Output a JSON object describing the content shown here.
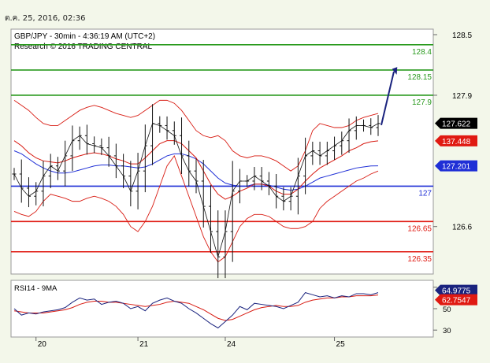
{
  "header": {
    "timestamp": "ต.ค. 25, 2016, 02:36"
  },
  "chart_data": [
    {
      "type": "line",
      "title": "GBP/JPY - 30min - 4:36:19 AM (UTC+2)",
      "subtitle": "Research © 2016 TRADING CENTRAL",
      "x_ticks": [
        "20",
        "21",
        "24",
        "25"
      ],
      "ylim": [
        126.2,
        128.5
      ],
      "y_ticks": [
        {
          "value": 128.5,
          "label": "128.5"
        },
        {
          "value": 127.9,
          "label": "127.9"
        },
        {
          "value": 126.6,
          "label": "126.6"
        }
      ],
      "levels": [
        {
          "value": 128.4,
          "label": "128.4",
          "color": "#2a9a1e",
          "role": "target"
        },
        {
          "value": 128.15,
          "label": "128.15",
          "color": "#2a9a1e",
          "role": "target"
        },
        {
          "value": 127.9,
          "label": "127.9",
          "color": "#2a9a1e",
          "role": "target"
        },
        {
          "value": 127.0,
          "label": "127",
          "color": "#1f2fd6",
          "role": "pivot"
        },
        {
          "value": 126.65,
          "label": "126.65",
          "color": "#e01a12",
          "role": "support"
        },
        {
          "value": 126.35,
          "label": "126.35",
          "color": "#e01a12",
          "role": "support"
        }
      ],
      "markers": [
        {
          "value": 127.622,
          "label": "127.622",
          "color": "#000000"
        },
        {
          "value": 127.448,
          "label": "137.448",
          "color": "#e01a12"
        },
        {
          "value": 127.201,
          "label": "127.201",
          "color": "#1f2fd6"
        }
      ],
      "series": [
        {
          "values": [
            127.12,
            126.98,
            126.9,
            126.95,
            127.1,
            127.2,
            127.15,
            127.3,
            127.45,
            127.5,
            127.42,
            127.4,
            127.38,
            127.3,
            127.2,
            127.1,
            126.95,
            127.15,
            127.4,
            127.62,
            127.6,
            127.55,
            127.5,
            127.3,
            127.15,
            127.05,
            126.8,
            126.55,
            126.3,
            126.55,
            126.95,
            127.05,
            127.05,
            127.1,
            127.05,
            127.0,
            126.9,
            126.85,
            126.9,
            127.1,
            127.3,
            127.35,
            127.3,
            127.35,
            127.4,
            127.45,
            127.55,
            127.6,
            127.6,
            127.58,
            127.62
          ]
        },
        {
          "values": [
            127.45,
            127.4,
            127.33,
            127.28,
            127.25,
            127.24,
            127.23,
            127.25,
            127.28,
            127.3,
            127.32,
            127.33,
            127.32,
            127.3,
            127.27,
            127.25,
            127.22,
            127.22,
            127.28,
            127.35,
            127.42,
            127.45,
            127.45,
            127.42,
            127.35,
            127.28,
            127.15,
            127.02,
            126.92,
            126.87,
            126.9,
            126.95,
            126.98,
            127.02,
            127.02,
            127.0,
            126.95,
            126.92,
            126.92,
            126.97,
            127.05,
            127.12,
            127.18,
            127.22,
            127.26,
            127.3,
            127.35,
            127.38,
            127.42,
            127.44,
            127.448
          ]
        },
        {
          "values": [
            127.35,
            127.32,
            127.27,
            127.22,
            127.18,
            127.15,
            127.13,
            127.13,
            127.14,
            127.16,
            127.18,
            127.2,
            127.21,
            127.21,
            127.2,
            127.2,
            127.19,
            127.18,
            127.19,
            127.22,
            127.26,
            127.3,
            127.32,
            127.32,
            127.3,
            127.27,
            127.22,
            127.15,
            127.08,
            127.03,
            127.01,
            127.0,
            127.0,
            127.02,
            127.02,
            127.01,
            126.99,
            126.97,
            126.96,
            126.97,
            127.0,
            127.04,
            127.08,
            127.1,
            127.12,
            127.14,
            127.16,
            127.18,
            127.19,
            127.2,
            127.201
          ]
        },
        {
          "values": [
            127.85,
            127.8,
            127.75,
            127.68,
            127.62,
            127.6,
            127.6,
            127.65,
            127.7,
            127.75,
            127.78,
            127.8,
            127.78,
            127.75,
            127.72,
            127.7,
            127.68,
            127.7,
            127.75,
            127.8,
            127.85,
            127.85,
            127.82,
            127.75,
            127.65,
            127.55,
            127.5,
            127.48,
            127.5,
            127.45,
            127.35,
            127.3,
            127.28,
            127.3,
            127.3,
            127.28,
            127.25,
            127.2,
            127.15,
            127.2,
            127.35,
            127.55,
            127.62,
            127.6,
            127.58,
            127.58,
            127.6,
            127.65,
            127.68,
            127.7,
            127.72
          ]
        },
        {
          "values": [
            126.75,
            126.72,
            126.7,
            126.75,
            126.85,
            126.92,
            126.9,
            126.88,
            126.85,
            126.85,
            126.88,
            126.9,
            126.88,
            126.85,
            126.8,
            126.72,
            126.6,
            126.55,
            126.65,
            126.8,
            127.0,
            127.2,
            127.3,
            127.1,
            126.9,
            126.7,
            126.5,
            126.35,
            126.25,
            126.3,
            126.45,
            126.6,
            126.68,
            126.72,
            126.72,
            126.7,
            126.65,
            126.6,
            126.58,
            126.58,
            126.6,
            126.65,
            126.78,
            126.85,
            126.9,
            126.95,
            127.0,
            127.05,
            127.08,
            127.12,
            127.15
          ]
        }
      ]
    },
    {
      "type": "line",
      "title": "RSI14 - 9MA",
      "ylim": [
        25,
        75
      ],
      "y_ticks": [
        {
          "value": 70,
          "label": "70"
        },
        {
          "value": 50,
          "label": "50"
        },
        {
          "value": 30,
          "label": "30"
        }
      ],
      "markers": [
        {
          "value": 64.9775,
          "label": "64.9775",
          "color": "#1a237e"
        },
        {
          "value": 62.7547,
          "label": "62.7547",
          "color": "#e01a12"
        }
      ],
      "series": [
        {
          "values": [
            50,
            44,
            46,
            45,
            47,
            48,
            49,
            51,
            56,
            60,
            58,
            59,
            54,
            56,
            57,
            55,
            50,
            52,
            48,
            55,
            58,
            60,
            57,
            55,
            50,
            46,
            41,
            36,
            32,
            38,
            44,
            52,
            49,
            55,
            54,
            53,
            52,
            50,
            53,
            56,
            65,
            63,
            61,
            62,
            60,
            62,
            61,
            64,
            64,
            63,
            65
          ]
        },
        {
          "values": [
            48,
            47,
            46,
            46,
            46,
            47,
            48,
            49,
            51,
            54,
            56,
            57,
            57,
            56,
            56,
            55,
            54,
            53,
            52,
            53,
            54,
            56,
            57,
            56,
            55,
            52,
            49,
            45,
            41,
            39,
            40,
            43,
            46,
            49,
            51,
            52,
            53,
            52,
            52,
            53,
            56,
            58,
            59,
            60,
            60,
            61,
            61,
            62,
            62,
            62,
            62.75
          ]
        }
      ]
    }
  ]
}
